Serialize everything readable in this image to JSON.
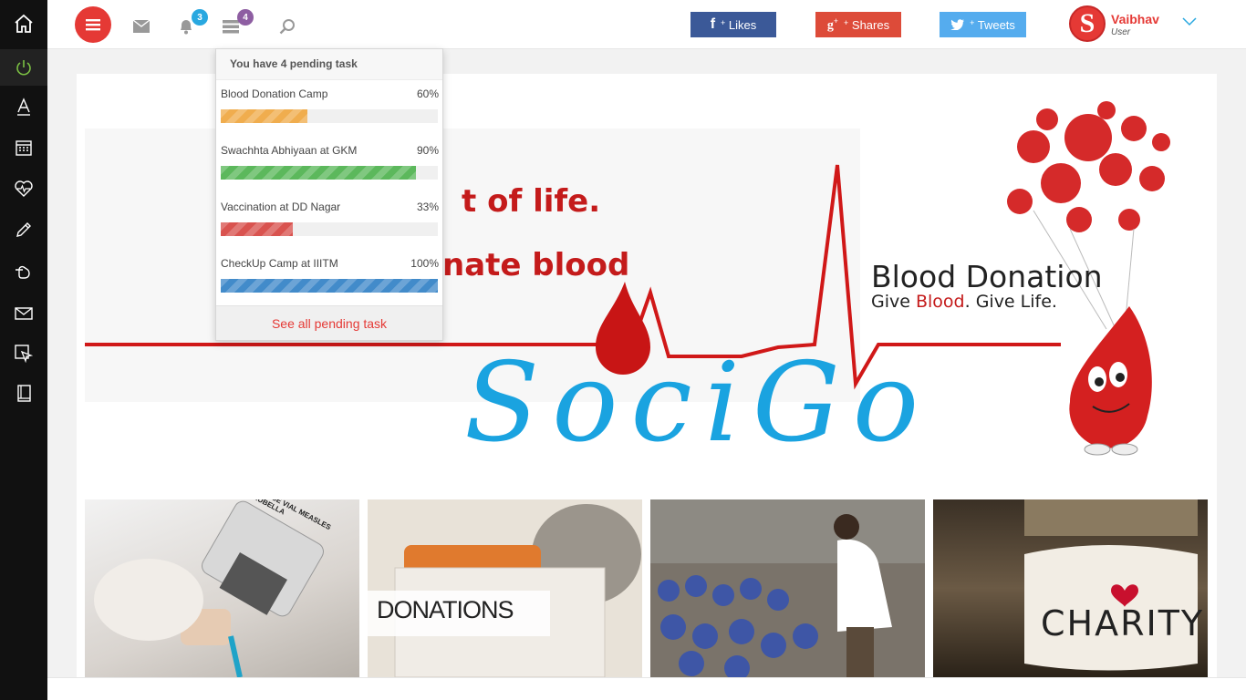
{
  "sidebar": {
    "items": [
      {
        "icon": "home-icon"
      },
      {
        "icon": "power-icon"
      },
      {
        "icon": "font-icon"
      },
      {
        "icon": "calendar-icon"
      },
      {
        "icon": "heartbeat-icon"
      },
      {
        "icon": "pencil-icon"
      },
      {
        "icon": "hand-pointer-icon"
      },
      {
        "icon": "envelope-icon"
      },
      {
        "icon": "cursor-icon"
      },
      {
        "icon": "book-icon"
      }
    ]
  },
  "topbar": {
    "notifications_count": "3",
    "tasks_count": "4",
    "social": {
      "likes": "Likes",
      "shares": "Shares",
      "tweets": "Tweets",
      "plus": "+"
    },
    "user": {
      "initial": "S",
      "name": "Vaibhav",
      "role": "User"
    }
  },
  "tasks_dropdown": {
    "header": "You have 4 pending task",
    "tasks": [
      {
        "name": "Blood Donation Camp",
        "percent_label": "60%",
        "progress": 0.4,
        "color": "#f0ad4e"
      },
      {
        "name": "Swachhta Abhiyaan at GKM",
        "percent_label": "90%",
        "progress": 0.9,
        "color": "#5cb85c"
      },
      {
        "name": "Vaccination at DD Nagar",
        "percent_label": "33%",
        "progress": 0.33,
        "color": "#d9534f"
      },
      {
        "name": "CheckUp Camp at IIITM",
        "percent_label": "100%",
        "progress": 1.0,
        "color": "#428bca"
      }
    ],
    "footer": "See all pending task"
  },
  "hero": {
    "line1": "t of life.",
    "line2": "nate blood",
    "bd_title": "Blood Donation",
    "bd_sub_give": "Give ",
    "bd_sub_blood": "Blood",
    "bd_sub_rest": ". Give Life.",
    "logo": "SociGo"
  },
  "thumbnails": {
    "vaccine_label": "1 DOSE VIAL MEASLES RUBELLA",
    "donations_label": "DONATIONS",
    "charity_label": "CHARITY"
  },
  "colors": {
    "accent": "#e53935",
    "facebook": "#3b5998",
    "googleplus": "#dd4b39",
    "twitter": "#55acee",
    "logo_blue": "#1aa3e0"
  }
}
